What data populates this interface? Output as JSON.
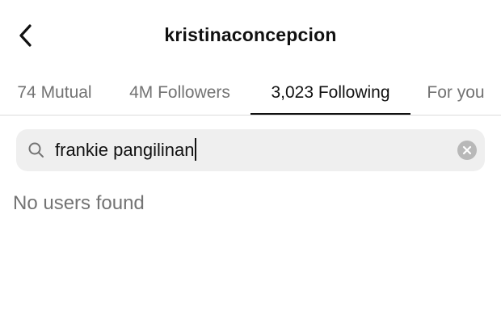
{
  "header": {
    "back_icon": "chevron-left-icon",
    "username": "kristinaconcepcion"
  },
  "tabs": [
    {
      "label": "74 Mutual",
      "active": false
    },
    {
      "label": "4M Followers",
      "active": false
    },
    {
      "label": "3,023 Following",
      "active": true
    },
    {
      "label": "For you",
      "active": false
    }
  ],
  "search": {
    "icon": "search-icon",
    "value": "frankie pangilinan",
    "clear_icon": "clear-icon"
  },
  "results": {
    "empty_message": "No users found"
  },
  "colors": {
    "text_primary": "#111111",
    "text_secondary": "#737373",
    "search_background": "#efefef",
    "divider": "#dbdbdb"
  }
}
